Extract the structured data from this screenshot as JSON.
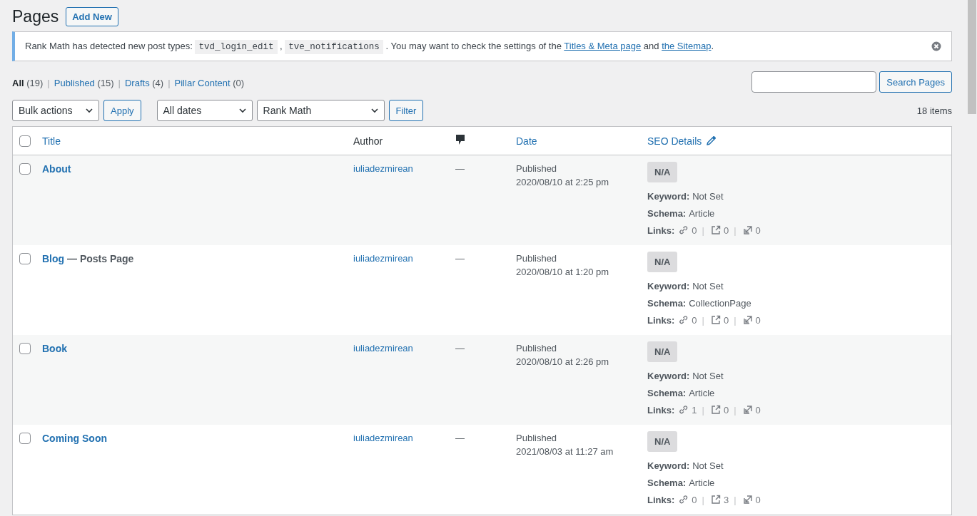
{
  "page_title": "Pages",
  "add_new": "Add New",
  "notice": {
    "segments": [
      {
        "kind": "text",
        "text": "Rank Math has detected new post types: "
      },
      {
        "kind": "code",
        "text": "tvd_login_edit"
      },
      {
        "kind": "text",
        "text": " , "
      },
      {
        "kind": "code",
        "text": "tve_notifications"
      },
      {
        "kind": "text",
        "text": " . You may want to check the settings of the "
      },
      {
        "kind": "link",
        "text": "Titles & Meta page"
      },
      {
        "kind": "text",
        "text": " and "
      },
      {
        "kind": "link",
        "text": "the Sitemap"
      },
      {
        "kind": "text",
        "text": "."
      }
    ]
  },
  "views": [
    {
      "label": "All",
      "count": "(19)",
      "selected": true
    },
    {
      "separator": "|",
      "label": "Published",
      "count": "(15)",
      "selected": false
    },
    {
      "separator": "|",
      "label": "Drafts",
      "count": "(4)",
      "selected": false
    },
    {
      "separator": "|",
      "label": "Pillar Content",
      "count": "(0)",
      "selected": false
    }
  ],
  "search": {
    "button": "Search Pages"
  },
  "toolbar": {
    "bulk": "Bulk actions",
    "apply": "Apply",
    "dates": "All dates",
    "seo_filter": "Rank Math",
    "filter": "Filter",
    "items_count": "18 items"
  },
  "table": {
    "columns": {
      "title": "Title",
      "author": "Author",
      "date": "Date",
      "seo": "SEO Details"
    },
    "select_all_checked": false,
    "rows": [
      {
        "checked": false,
        "title": "About",
        "author": "iuliadezmirean",
        "comments": "—",
        "status": "Published",
        "date": "2020/08/10 at 2:25 pm",
        "score": "N/A",
        "keyword_label": "Keyword:",
        "keyword": "Not Set",
        "schema_label": "Schema:",
        "schema": "Article",
        "links_label": "Links:",
        "internal": "0",
        "external": "0",
        "incoming": "0",
        "separators": [
          "|",
          "|"
        ]
      },
      {
        "checked": false,
        "title": "Blog",
        "post_state": "— Posts Page",
        "author": "iuliadezmirean",
        "comments": "—",
        "status": "Published",
        "date": "2020/08/10 at 1:20 pm",
        "score": "N/A",
        "keyword_label": "Keyword:",
        "keyword": "Not Set",
        "schema_label": "Schema:",
        "schema": "CollectionPage",
        "links_label": "Links:",
        "internal": "0",
        "external": "0",
        "incoming": "0",
        "separators": [
          "|",
          "|"
        ]
      },
      {
        "checked": false,
        "title": "Book",
        "author": "iuliadezmirean",
        "comments": "—",
        "status": "Published",
        "date": "2020/08/10 at 2:26 pm",
        "score": "N/A",
        "keyword_label": "Keyword:",
        "keyword": "Not Set",
        "schema_label": "Schema:",
        "schema": "Article",
        "links_label": "Links:",
        "internal": "1",
        "external": "0",
        "incoming": "0",
        "separators": [
          "|",
          "|"
        ]
      },
      {
        "checked": false,
        "title": "Coming Soon",
        "author": "iuliadezmirean",
        "comments": "—",
        "status": "Published",
        "date": "2021/08/03 at 11:27 am",
        "score": "N/A",
        "keyword_label": "Keyword:",
        "keyword": "Not Set",
        "schema_label": "Schema:",
        "schema": "Article",
        "links_label": "Links:",
        "internal": "0",
        "external": "3",
        "incoming": "0",
        "separators": [
          "|",
          "|"
        ]
      }
    ]
  }
}
